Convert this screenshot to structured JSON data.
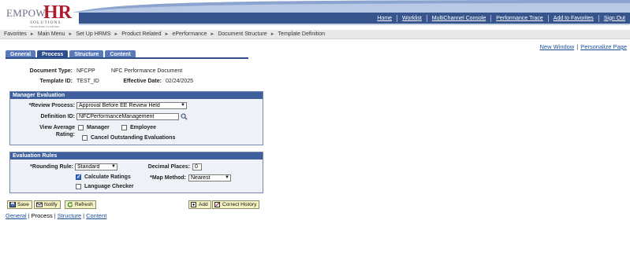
{
  "logo": {
    "word": "EMPOW",
    "hr": "HR",
    "sub": "SOLUTIONS",
    "tagline": "FROM HIRE TO RETIRE"
  },
  "topnav": {
    "links": [
      "Home",
      "Worklist",
      "MultiChannel Console",
      "Performance Trace",
      "Add to Favorites",
      "Sign Out"
    ]
  },
  "breadcrumb": [
    "Favorites",
    "Main Menu",
    "Set Up HRMS",
    "Product Related",
    "ePerformance",
    "Document Structure",
    "Template Definition"
  ],
  "page_links": {
    "new_window": "New Window",
    "personalize": "Personalize Page"
  },
  "tabs": [
    {
      "label": "General",
      "active": false
    },
    {
      "label": "Process",
      "active": true
    },
    {
      "label": "Structure",
      "active": false
    },
    {
      "label": "Content",
      "active": false
    }
  ],
  "header": {
    "doc_type_label": "Document Type:",
    "doc_type_value": "NFCPP",
    "doc_type_desc": "NFC Performance Document",
    "template_id_label": "Template ID:",
    "template_id_value": "TEST_ID",
    "eff_date_label": "Effective Date:",
    "eff_date_value": "02/24/2025"
  },
  "manager_evaluation": {
    "title": "Manager Evaluation",
    "review_process_label": "*Review Process:",
    "review_process_value": "Approval Before EE Review Held",
    "definition_id_label": "Definition ID:",
    "definition_id_value": "NFCPerformanceManagement",
    "view_avg_label_1": "View Average",
    "view_avg_label_2": "Rating:",
    "manager_label": "Manager",
    "employee_label": "Employee",
    "cancel_label": "Cancel Outstanding Evaluations",
    "manager_checked": false,
    "employee_checked": false,
    "cancel_checked": false
  },
  "evaluation_rules": {
    "title": "Evaluation Rules",
    "rounding_label": "*Rounding Rule:",
    "rounding_value": "Standard",
    "decimal_label": "Decimal Places:",
    "decimal_value": "0",
    "calc_label": "Calculate Ratings",
    "calc_checked": true,
    "lang_label": "Language Checker",
    "lang_checked": false,
    "map_label": "*Map Method:",
    "map_value": "Nearest"
  },
  "buttons": {
    "save": "Save",
    "notify": "Notify",
    "refresh": "Refresh",
    "add": "Add",
    "correct_history": "Correct History"
  },
  "bottom_links": [
    "General",
    "Process",
    "Structure",
    "Content"
  ],
  "colors": {
    "nav_blue": "#37558c",
    "tab_blue": "#5a79b8",
    "group_head": "#3e5f9c",
    "button_yellow": "#f5f2c2",
    "logo_red": "#b01a2e"
  }
}
